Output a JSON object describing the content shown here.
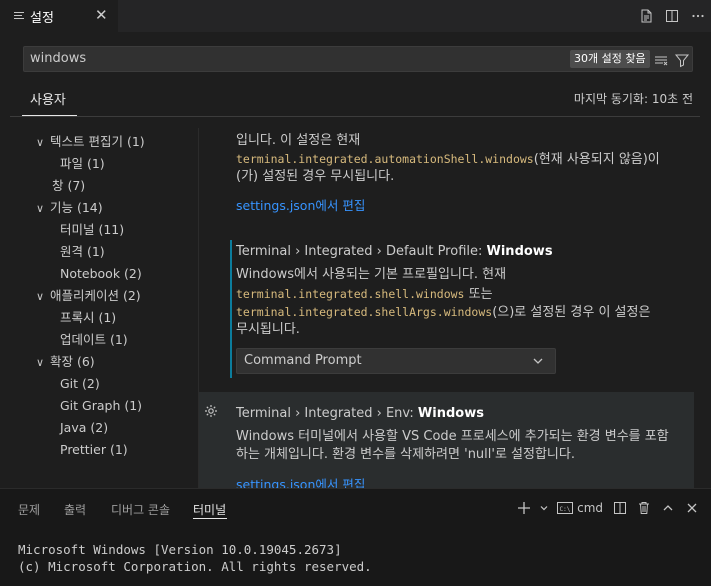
{
  "tab": {
    "label": "설정",
    "close": "✕"
  },
  "search": {
    "value": "windows",
    "result_count": "30개 설정 찾음"
  },
  "scope": {
    "active_tab": "사용자",
    "last_sync": "마지막 동기화: 10초 전"
  },
  "toc": [
    {
      "label": "텍스트 편집기 (1)",
      "expanded": true
    },
    {
      "label": "파일 (1)"
    },
    {
      "label": "창 (7)"
    },
    {
      "label": "기능 (14)",
      "expanded": true
    },
    {
      "label": "터미널 (11)"
    },
    {
      "label": "원격 (1)"
    },
    {
      "label": "Notebook (2)"
    },
    {
      "label": "애플리케이션 (2)",
      "expanded": true
    },
    {
      "label": "프록시 (1)"
    },
    {
      "label": "업데이트 (1)"
    },
    {
      "label": "확장 (6)",
      "expanded": true
    },
    {
      "label": "Git (2)"
    },
    {
      "label": "Git Graph (1)"
    },
    {
      "label": "Java (2)"
    },
    {
      "label": "Prettier (1)"
    }
  ],
  "setting_top": {
    "line1": "입니다. 이 설정은 현재",
    "code": "terminal.integrated.automationShell.windows",
    "line2_suffix": "(현재 사용되지 않음)이",
    "line3": "(가) 설정된 경우 무시됩니다.",
    "edit_link": "settings.json에서 편집"
  },
  "setting_default_profile": {
    "category": "Terminal › Integrated › Default Profile: ",
    "name": "Windows",
    "desc1": "Windows에서 사용되는 기본 프로필입니다. 현재",
    "code1": "terminal.integrated.shell.windows",
    "desc2_suffix": " 또는",
    "code2": "terminal.integrated.shellArgs.windows",
    "desc3_suffix": "(으)로 설정된 경우 이 설정은",
    "desc4": "무시됩니다.",
    "dropdown_value": "Command Prompt"
  },
  "setting_env": {
    "category": "Terminal › Integrated › Env: ",
    "name": "Windows",
    "desc1": "Windows 터미널에서 사용할 VS Code 프로세스에 추가되는 환경 변수를 포함",
    "desc2": "하는 개체입니다. 환경 변수를 삭제하려면 'null'로 설정합니다.",
    "edit_link": "settings.json에서 편집"
  },
  "panel": {
    "tabs": [
      "문제",
      "출력",
      "디버그 콘솔",
      "터미널"
    ],
    "active_tab": "터미널",
    "terminal_name": "cmd",
    "terminal_lines": [
      "Microsoft Windows [Version 10.0.19045.2673]",
      "(c) Microsoft Corporation. All rights reserved."
    ]
  },
  "colors": {
    "accent_link": "#3794ff",
    "code": "#d7ba7d",
    "modified_bar": "#0c7d9d",
    "background": "#1e1e1e"
  }
}
